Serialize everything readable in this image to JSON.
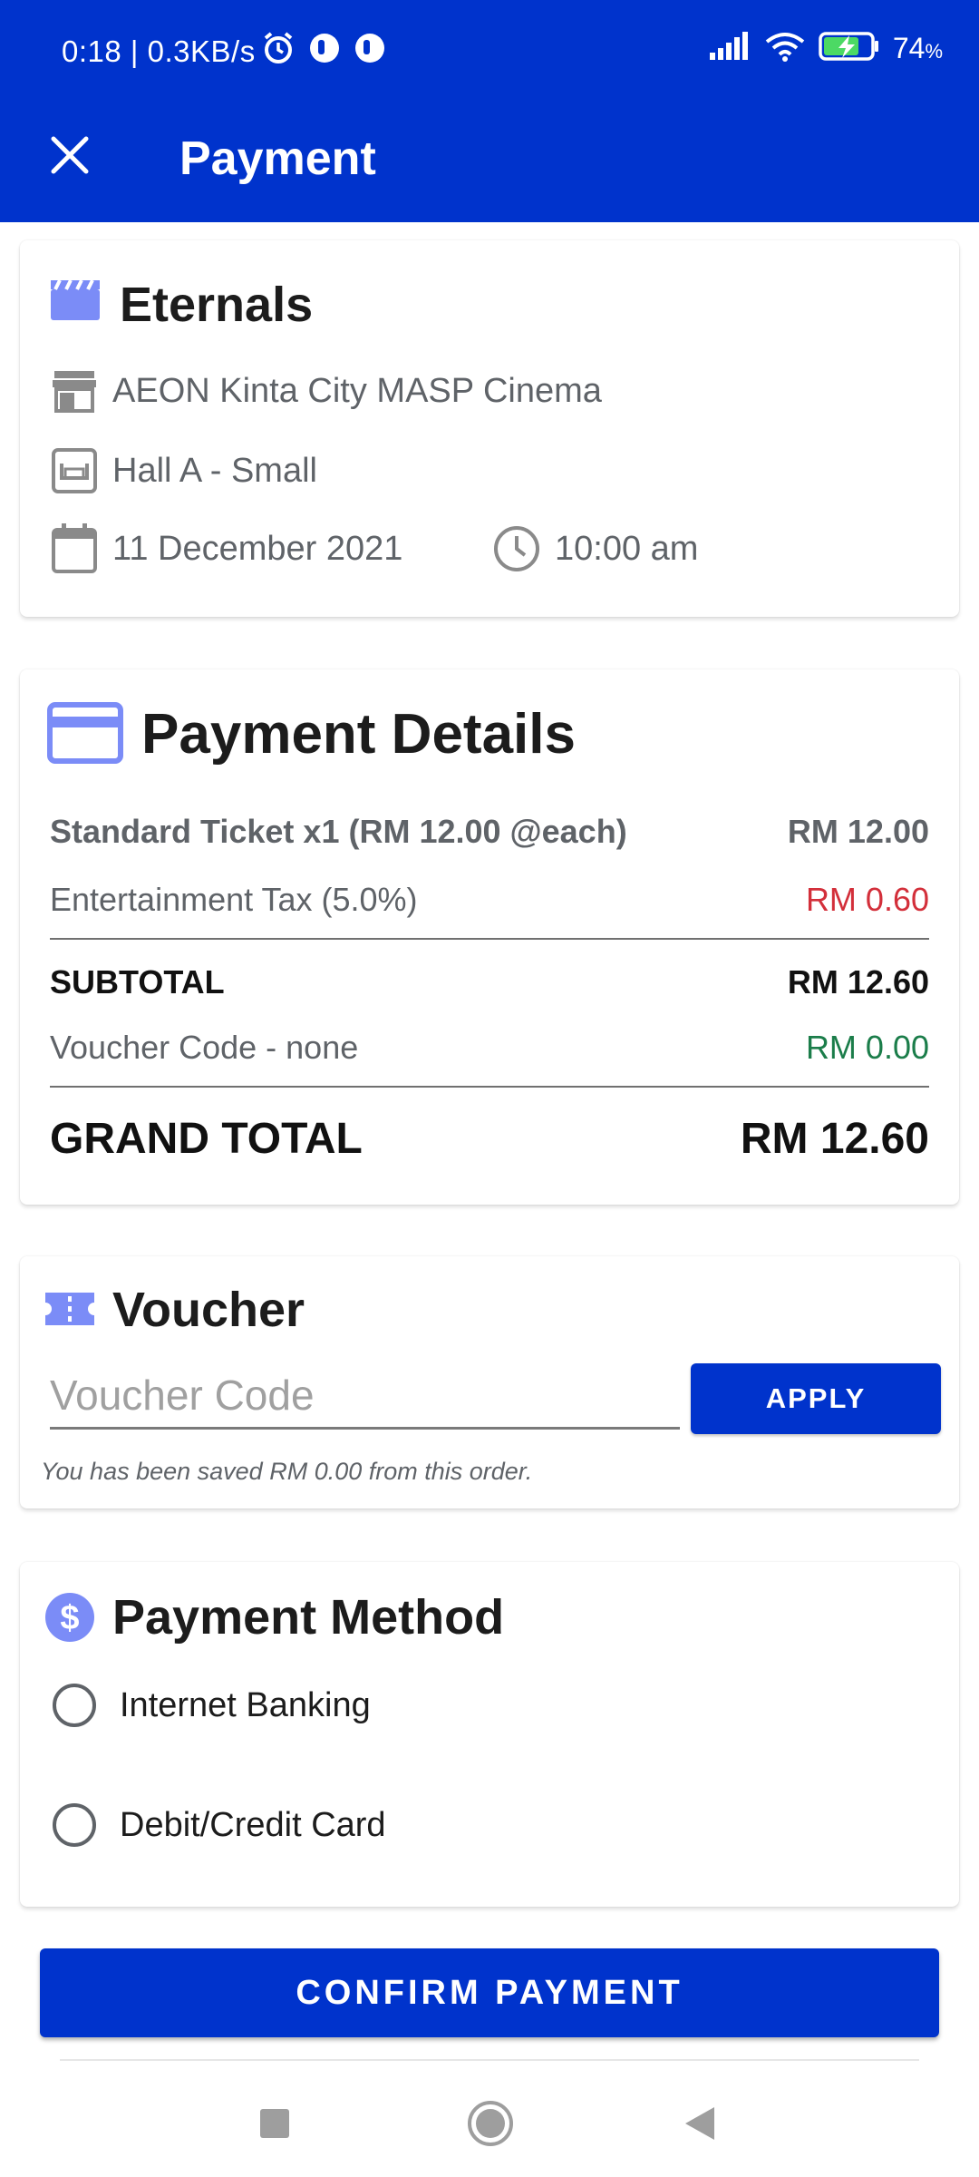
{
  "status_bar": {
    "time_speed": "0:18 | 0.3KB/s",
    "battery": "74",
    "battery_unit": "%",
    "icons": [
      "alarm-icon",
      "app-notification-icon",
      "app-notification-icon",
      "signal-icon",
      "wifi-icon",
      "battery-charging-icon"
    ]
  },
  "app_bar": {
    "title": "Payment",
    "close_icon": "close-icon"
  },
  "movie": {
    "title": "Eternals",
    "cinema": "AEON Kinta City MASP Cinema",
    "hall": "Hall A - Small",
    "date": "11 December 2021",
    "time": "10:00 am"
  },
  "payment_details": {
    "title": "Payment Details",
    "ticket_label": "Standard Ticket x1 (RM 12.00 @each)",
    "ticket_amount": "RM 12.00",
    "tax_label": "Entertainment Tax (5.0%)",
    "tax_amount": "RM 0.60",
    "subtotal_label": "SUBTOTAL",
    "subtotal_amount": "RM 12.60",
    "voucher_label": "Voucher Code - none",
    "voucher_amount": "RM 0.00",
    "grand_total_label": "GRAND TOTAL",
    "grand_total_amount": "RM 12.60"
  },
  "voucher": {
    "title": "Voucher",
    "input_placeholder": "Voucher Code",
    "input_value": "",
    "apply_label": "APPLY",
    "saved_note": "You has been saved RM 0.00 from this order."
  },
  "payment_method": {
    "title": "Payment Method",
    "options": [
      "Internet Banking",
      "Debit/Credit Card"
    ]
  },
  "confirm_label": "CONFIRM PAYMENT",
  "colors": {
    "primary": "#0033cc",
    "icon_accent": "#7b8cf7",
    "tax_red": "#d32f3a",
    "voucher_green": "#1b7d4a"
  }
}
